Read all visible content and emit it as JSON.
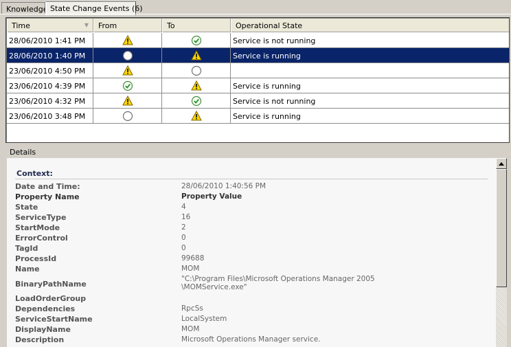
{
  "tabs": [
    {
      "label": "Knowledge"
    },
    {
      "label": "State Change Events (6)"
    }
  ],
  "grid": {
    "columns": [
      "Time",
      "From",
      "To",
      "Operational State"
    ],
    "rows": [
      {
        "time": "28/06/2010 1:41 PM",
        "from": "warning",
        "to": "success",
        "state": "Service is not running"
      },
      {
        "time": "28/06/2010 1:40 PM",
        "from": "uninitialized",
        "to": "warning",
        "state": "Service is running"
      },
      {
        "time": "23/06/2010 4:50 PM",
        "from": "warning",
        "to": "uninitialized",
        "state": ""
      },
      {
        "time": "23/06/2010 4:39 PM",
        "from": "success",
        "to": "warning",
        "state": "Service is running"
      },
      {
        "time": "23/06/2010 4:32 PM",
        "from": "warning",
        "to": "success",
        "state": "Service is not running"
      },
      {
        "time": "23/06/2010 3:48 PM",
        "from": "uninitialized",
        "to": "warning",
        "state": "Service is running"
      }
    ],
    "selected_row": 1
  },
  "details": {
    "label": "Details",
    "context": "Context:",
    "date_label": "Date and Time:",
    "date_value": "28/06/2010 1:40:56 PM",
    "prop_header": "Property Name",
    "value_header": "Property Value",
    "properties": [
      {
        "name": "State",
        "value": "4"
      },
      {
        "name": "ServiceType",
        "value": "16"
      },
      {
        "name": "StartMode",
        "value": "2"
      },
      {
        "name": "ErrorControl",
        "value": "0"
      },
      {
        "name": "TagId",
        "value": "0"
      },
      {
        "name": "ProcessId",
        "value": "99688"
      },
      {
        "name": "Name",
        "value": "MOM"
      },
      {
        "name": "BinaryPathName",
        "value": "\"C:\\Program Files\\Microsoft Operations Manager 2005 \\MOMService.exe\""
      },
      {
        "name": "LoadOrderGroup",
        "value": ""
      },
      {
        "name": "Dependencies",
        "value": "RpcSs"
      },
      {
        "name": "ServiceStartName",
        "value": "LocalSystem"
      },
      {
        "name": "DisplayName",
        "value": "MOM"
      },
      {
        "name": "Description",
        "value": "Microsoft Operations Manager service."
      }
    ]
  },
  "colors": {
    "selection": "#0a246a",
    "warning": "#ffd800",
    "success": "#2e8b2e"
  }
}
